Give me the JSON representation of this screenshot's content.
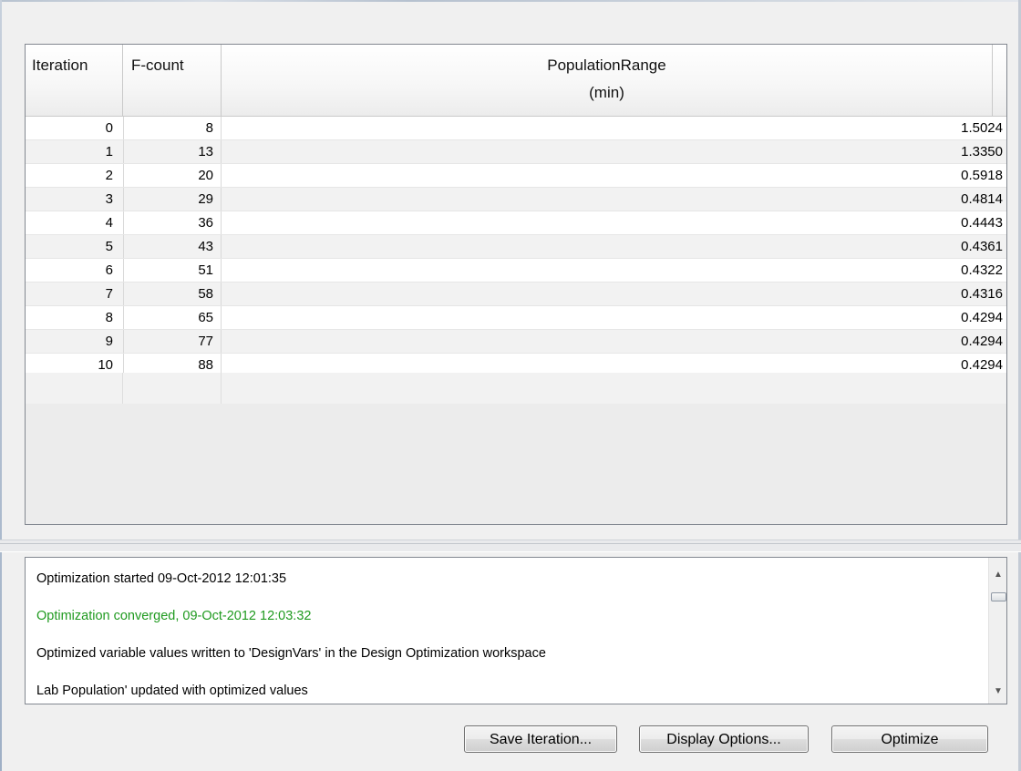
{
  "table": {
    "headers": {
      "iteration": "Iteration",
      "fcount": "F-count",
      "range_line1": "PopulationRange",
      "range_line2": "(min)"
    },
    "rows": [
      {
        "iteration": "0",
        "fcount": "8",
        "range": "1.5024"
      },
      {
        "iteration": "1",
        "fcount": "13",
        "range": "1.3350"
      },
      {
        "iteration": "2",
        "fcount": "20",
        "range": "0.5918"
      },
      {
        "iteration": "3",
        "fcount": "29",
        "range": "0.4814"
      },
      {
        "iteration": "4",
        "fcount": "36",
        "range": "0.4443"
      },
      {
        "iteration": "5",
        "fcount": "43",
        "range": "0.4361"
      },
      {
        "iteration": "6",
        "fcount": "51",
        "range": "0.4322"
      },
      {
        "iteration": "7",
        "fcount": "58",
        "range": "0.4316"
      },
      {
        "iteration": "8",
        "fcount": "65",
        "range": "0.4294"
      },
      {
        "iteration": "9",
        "fcount": "77",
        "range": "0.4294"
      },
      {
        "iteration": "10",
        "fcount": "88",
        "range": "0.4294"
      }
    ]
  },
  "log": {
    "lines": [
      {
        "text": "Optimization started 09-Oct-2012 12:01:35",
        "status": "info"
      },
      {
        "text": "Optimization converged, 09-Oct-2012 12:03:32",
        "status": "success"
      },
      {
        "text": "Optimized variable values written to 'DesignVars' in the Design Optimization workspace",
        "status": "info"
      },
      {
        "text": "Lab Population' updated with optimized values",
        "status": "info"
      }
    ],
    "success_color": "#1f9a1f",
    "scroll_up_icon": "scroll-up-arrow",
    "scroll_down_icon": "scroll-down-arrow"
  },
  "buttons": {
    "save_iteration": "Save Iteration...",
    "display_options": "Display Options...",
    "optimize": "Optimize"
  }
}
